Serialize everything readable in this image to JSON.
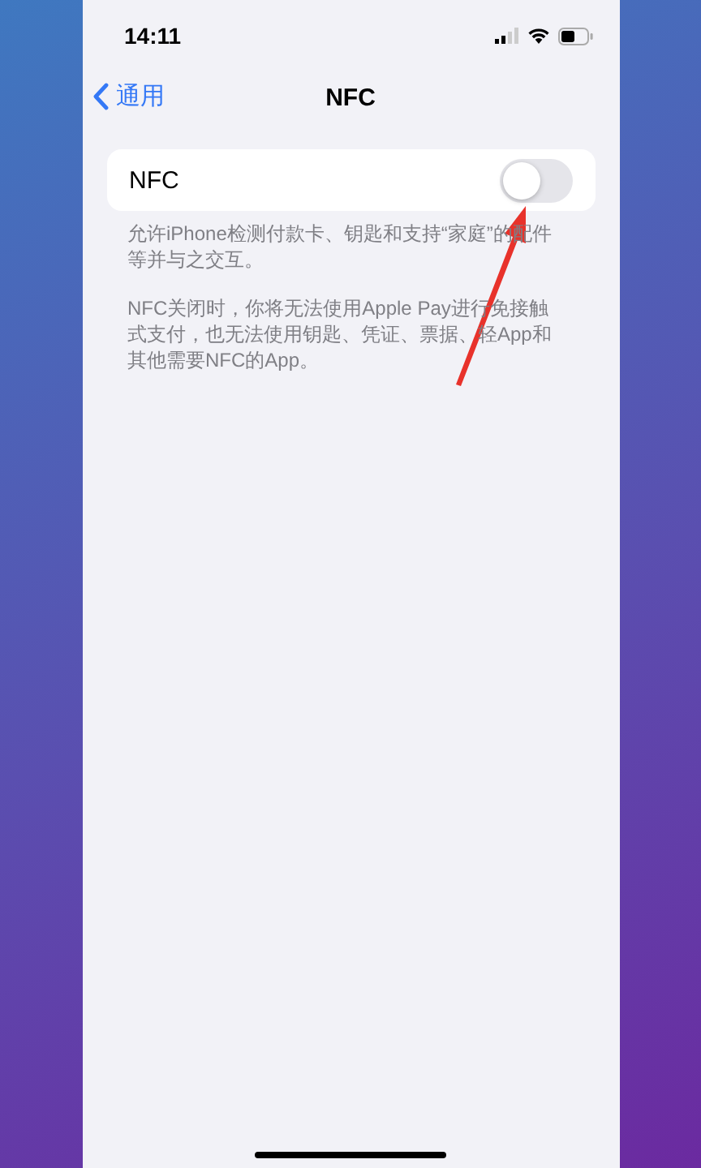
{
  "status_bar": {
    "time": "14:11"
  },
  "nav": {
    "back_label": "通用",
    "title": "NFC"
  },
  "setting": {
    "label": "NFC",
    "on": false
  },
  "descriptions": [
    "允许iPhone检测付款卡、钥匙和支持“家庭”的配件等并与之交互。",
    "NFC关闭时，你将无法使用Apple Pay进行免接触式支付，也无法使用钥匙、凭证、票据、轻App和其他需要NFC的App。"
  ]
}
